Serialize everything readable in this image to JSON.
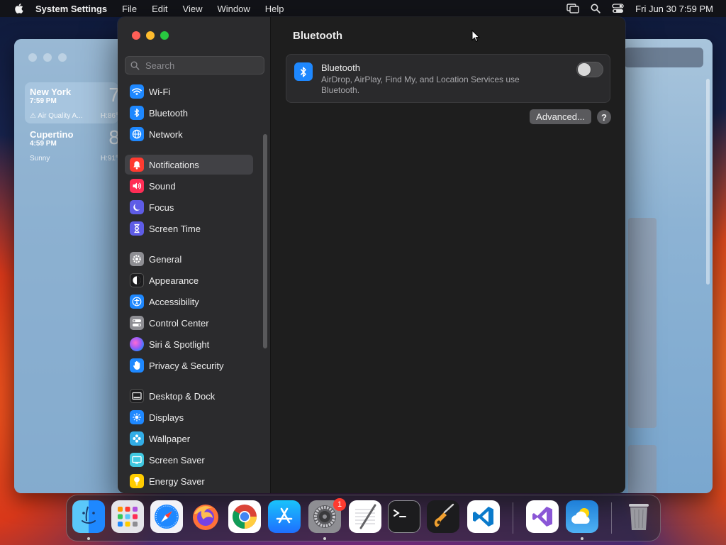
{
  "menubar": {
    "app_name": "System Settings",
    "menus": [
      "File",
      "Edit",
      "View",
      "Window",
      "Help"
    ],
    "clock": "Fri Jun 30  7:59 PM"
  },
  "weather": {
    "cities": [
      {
        "name": "New York",
        "time": "7:59 PM",
        "temp": "7",
        "condition": "Air Quality A...",
        "high": "H:86°"
      },
      {
        "name": "Cupertino",
        "time": "4:59 PM",
        "temp": "8",
        "condition": "Sunny",
        "high": "H:91°"
      }
    ]
  },
  "sidebar": {
    "search_placeholder": "Search",
    "items": [
      {
        "label": "Wi-Fi",
        "icon": "wifi-icon",
        "color": "#1e88ff"
      },
      {
        "label": "Bluetooth",
        "icon": "bluetooth-icon",
        "color": "#1e88ff"
      },
      {
        "label": "Network",
        "icon": "globe-icon",
        "color": "#1e88ff"
      },
      {
        "label": "Notifications",
        "icon": "bell-icon",
        "color": "#ff3b30",
        "selected": true
      },
      {
        "label": "Sound",
        "icon": "speaker-icon",
        "color": "#ff2d55"
      },
      {
        "label": "Focus",
        "icon": "moon-icon",
        "color": "#5e5ce6"
      },
      {
        "label": "Screen Time",
        "icon": "hourglass-icon",
        "color": "#5e5ce6"
      },
      {
        "label": "General",
        "icon": "gear-icon",
        "color": "#8e8e93"
      },
      {
        "label": "Appearance",
        "icon": "appearance-icon",
        "color": "#1c1c1e"
      },
      {
        "label": "Accessibility",
        "icon": "accessibility-icon",
        "color": "#1e88ff"
      },
      {
        "label": "Control Center",
        "icon": "control-center-icon",
        "color": "#8e8e93"
      },
      {
        "label": "Siri & Spotlight",
        "icon": "siri-icon",
        "color": "#b04bd6"
      },
      {
        "label": "Privacy & Security",
        "icon": "hand-icon",
        "color": "#1e88ff"
      },
      {
        "label": "Desktop & Dock",
        "icon": "dock-icon",
        "color": "#1c1c1e"
      },
      {
        "label": "Displays",
        "icon": "displays-icon",
        "color": "#1e88ff"
      },
      {
        "label": "Wallpaper",
        "icon": "wallpaper-icon",
        "color": "#32ade6"
      },
      {
        "label": "Screen Saver",
        "icon": "screen-saver-icon",
        "color": "#40c8e0"
      },
      {
        "label": "Energy Saver",
        "icon": "lightbulb-icon",
        "color": "#ffcc00"
      }
    ]
  },
  "main": {
    "title": "Bluetooth",
    "card": {
      "title": "Bluetooth",
      "description": "AirDrop, AirPlay, Find My, and Location Services use Bluetooth.",
      "toggle_on": false
    },
    "advanced_label": "Advanced...",
    "help_label": "?"
  },
  "dock": {
    "apps": [
      "Finder",
      "Launchpad",
      "Safari",
      "Firefox",
      "Chrome",
      "App Store",
      "System Settings",
      "TextEdit",
      "Terminal",
      "GarageBand",
      "Visual Studio Code",
      "Visual Studio",
      "Weather",
      "Trash"
    ],
    "settings_badge": "1"
  }
}
